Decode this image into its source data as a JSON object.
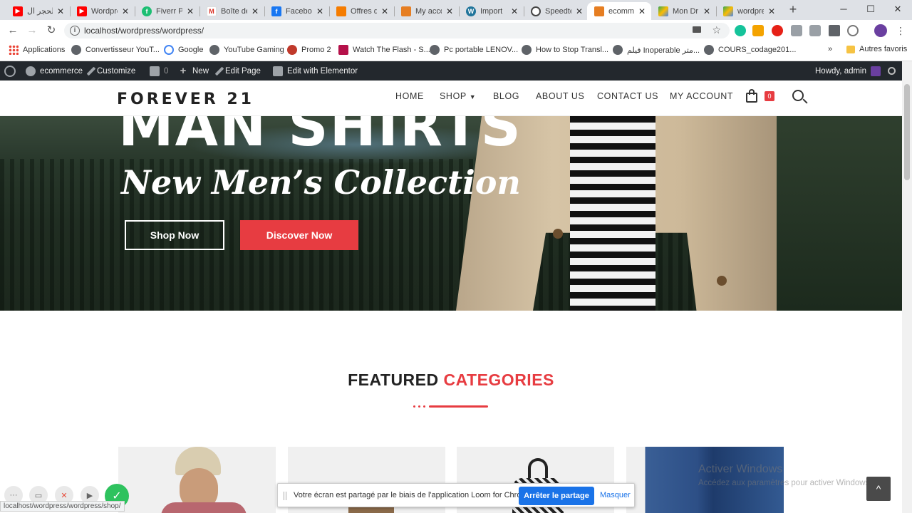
{
  "browser": {
    "tabs": [
      {
        "title": "الحجر ال",
        "icon": "youtube-icon",
        "color": "#ff0000"
      },
      {
        "title": "Wordpre",
        "icon": "youtube-icon",
        "color": "#ff0000"
      },
      {
        "title": "Fiverr Pr",
        "icon": "fiverr-icon",
        "color": "#1dbf73"
      },
      {
        "title": "Boîte de",
        "icon": "gmail-icon",
        "color": "#d93025"
      },
      {
        "title": "Faceboo",
        "icon": "facebook-icon",
        "color": "#1877f2"
      },
      {
        "title": "Offres d",
        "icon": "offers-icon",
        "color": "#f57c00"
      },
      {
        "title": "My acco",
        "icon": "site-icon",
        "color": "#e67e22"
      },
      {
        "title": "Import",
        "icon": "wordpress-icon",
        "color": "#21759b"
      },
      {
        "title": "Speedte",
        "icon": "speedtest-icon",
        "color": "#444444"
      },
      {
        "title": "ecomme",
        "icon": "site-icon",
        "color": "#e67e22",
        "active": true
      },
      {
        "title": "Mon Dr",
        "icon": "drive-icon",
        "color": "#34a853"
      },
      {
        "title": "wordpre",
        "icon": "drive-icon",
        "color": "#34a853"
      }
    ],
    "url": "localhost/wordpress/wordpress/",
    "bookmarks": [
      "Applications",
      "Convertisseur YouT...",
      "Google",
      "YouTube Gaming",
      "Promo 2",
      "Watch The Flash - S...",
      "Pc portable LENOV...",
      "How to Stop Transl...",
      "فيلم Inoperable متر...",
      "COURS_codage201...",
      "Autres favoris"
    ],
    "bookmarks_more": "»"
  },
  "wp_admin_bar": {
    "site": "ecommerce",
    "customize": "Customize",
    "comments": "0",
    "new": "New",
    "edit_page": "Edit Page",
    "elementor": "Edit with Elementor",
    "howdy": "Howdy, admin"
  },
  "site": {
    "logo": "FOREVER 21",
    "nav": [
      "HOME",
      "SHOP",
      "BLOG",
      "ABOUT US",
      "CONTACT US",
      "MY ACCOUNT"
    ],
    "cart_count": "0"
  },
  "hero": {
    "title": "MAN SHIRTS",
    "subtitle": "New Men’s Collection",
    "btn_shop": "Shop Now",
    "btn_discover": "Discover Now"
  },
  "featured": {
    "title_plain": "FEATURED ",
    "title_accent": "CATEGORIES"
  },
  "colors": {
    "accent": "#e73c41"
  },
  "windows": {
    "activate_title": "Activer Windows",
    "activate_sub": "Accédez aux paramètres pour activer Windows."
  },
  "loom": {
    "message": "Votre écran est partagé par le biais de l'application Loom for Chrome.",
    "stop": "Arrêter le partage",
    "hide": "Masquer"
  },
  "status_url": "localhost/wordpress/wordpress/shop/"
}
